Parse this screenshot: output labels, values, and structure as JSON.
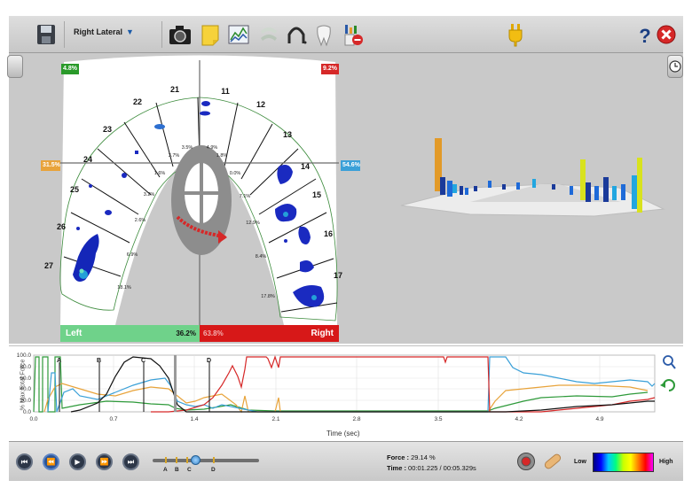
{
  "toolbar": {
    "view_label": "Right Lateral",
    "icons": [
      "save-icon",
      "camera-icon",
      "note-icon",
      "graph-icon",
      "force-icon",
      "arch-icon",
      "tooth-icon",
      "report-icon",
      "plug-icon",
      "help-icon",
      "close-icon"
    ]
  },
  "arch": {
    "badges": {
      "left_top": "4.8%",
      "right_top": "9.2%",
      "left_mid": "31.5%",
      "right_mid": "54.6%"
    },
    "teeth_left": [
      "21",
      "22",
      "23",
      "24",
      "25",
      "26",
      "27"
    ],
    "teeth_right": [
      "11",
      "12",
      "13",
      "14",
      "15",
      "16",
      "17"
    ],
    "pct_left": [
      "3.5%",
      "3.7%",
      "1.6%",
      "3.2%",
      "2.6%",
      "6.9%",
      "18.1%"
    ],
    "pct_right": [
      "4.9%",
      "1.8%",
      "0.0%",
      "7.1%",
      "12.9%",
      "8.4%",
      "17.8%"
    ],
    "left_label": "Left",
    "left_pct": "36.2%",
    "right_pct": "63.8%",
    "right_label": "Right"
  },
  "graph": {
    "y_title": "% Max Total Force",
    "y_ticks": [
      "100.0",
      "80.0",
      "60.0",
      "40.0",
      "20.0",
      "0.0"
    ],
    "x_ticks": [
      "0.0",
      "0.7",
      "1.4",
      "2.1",
      "2.8",
      "3.5",
      "4.2",
      "4.9"
    ],
    "x_title": "Time (sec)",
    "markers": [
      "A",
      "B",
      "C",
      "D"
    ],
    "cursor_time": 1.225
  },
  "playback": {
    "buttons": [
      "skip-start",
      "step-back",
      "play",
      "step-forward",
      "skip-end"
    ],
    "markers": [
      "A",
      "B",
      "C",
      "D"
    ],
    "force_label": "Force :",
    "force_value": "29.14 %",
    "time_label": "Time :",
    "time_value": "00:01.225 / 00:05.329s",
    "low_label": "Low",
    "high_label": "High"
  },
  "colors": {
    "left": "#6fd28a",
    "right": "#d71818",
    "red_line": "#d62828",
    "green_line": "#2e9a3a",
    "orange_line": "#e8a33a",
    "blue_line": "#3aa0d8",
    "black_line": "#111111"
  }
}
